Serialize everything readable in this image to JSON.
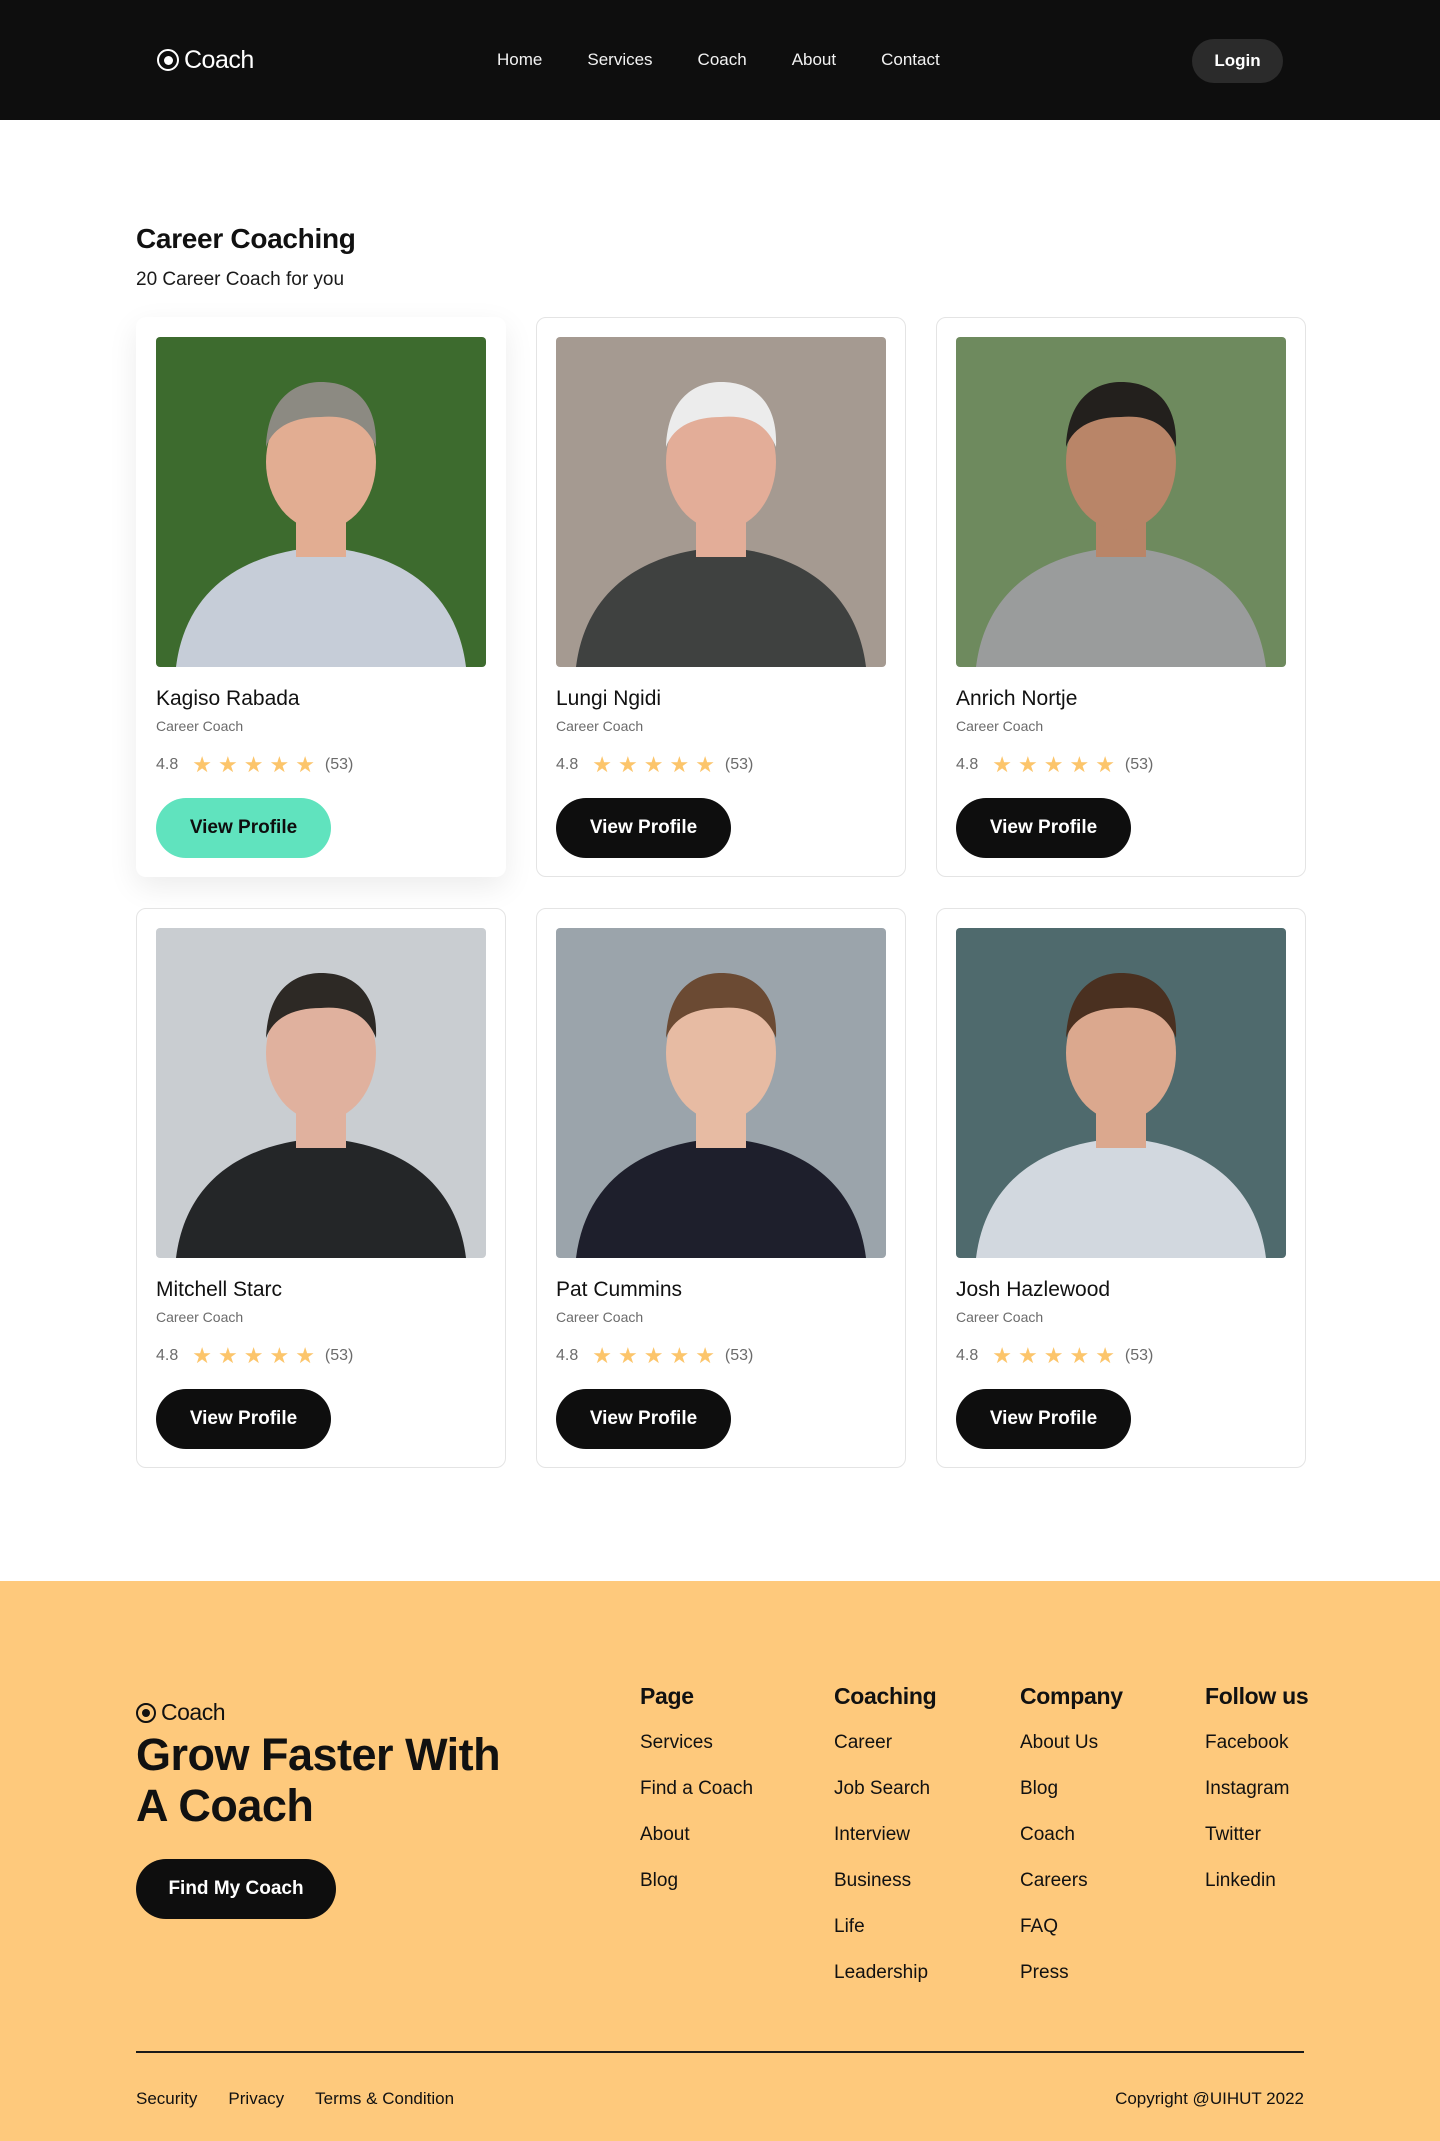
{
  "header": {
    "logo_text": "Coach",
    "nav": [
      "Home",
      "Services",
      "Coach",
      "About",
      "Contact"
    ],
    "login_label": "Login"
  },
  "main": {
    "title": "Career Coaching",
    "subtitle": "20 Career Coach for you",
    "coaches": [
      {
        "name": "Kagiso Rabada",
        "role": "Career Coach",
        "rating": "4.8",
        "stars": 5,
        "reviews": "(53)",
        "button": "View Profile",
        "active": true,
        "photo_bg": "#3d6b2e",
        "shirt": "#c6cdd8",
        "skin": "#e2ad92",
        "hair": "#8c8a82"
      },
      {
        "name": "Lungi Ngidi",
        "role": "Career Coach",
        "rating": "4.8",
        "stars": 5,
        "reviews": "(53)",
        "button": "View Profile",
        "active": false,
        "photo_bg": "#a59a91",
        "shirt": "#3f4140",
        "skin": "#e3ad98",
        "hair": "#ececec"
      },
      {
        "name": "Anrich Nortje",
        "role": "Career Coach",
        "rating": "4.8",
        "stars": 5,
        "reviews": "(53)",
        "button": "View Profile",
        "active": false,
        "photo_bg": "#6e8a5e",
        "shirt": "#9a9c9c",
        "skin": "#b98568",
        "hair": "#23201d"
      },
      {
        "name": "Mitchell Starc",
        "role": "Career Coach",
        "rating": "4.8",
        "stars": 5,
        "reviews": "(53)",
        "button": "View Profile",
        "active": false,
        "photo_bg": "#c9cdd1",
        "shirt": "#242628",
        "skin": "#e0b19e",
        "hair": "#2d2925"
      },
      {
        "name": "Pat Cummins",
        "role": "Career Coach",
        "rating": "4.8",
        "stars": 5,
        "reviews": "(53)",
        "button": "View Profile",
        "active": false,
        "photo_bg": "#9ba4ab",
        "shirt": "#1e1f2c",
        "skin": "#e7bba3",
        "hair": "#6b4a33"
      },
      {
        "name": "Josh Hazlewood",
        "role": "Career Coach",
        "rating": "4.8",
        "stars": 5,
        "reviews": "(53)",
        "button": "View Profile",
        "active": false,
        "photo_bg": "#4f6a6d",
        "shirt": "#d2d8df",
        "skin": "#dba88e",
        "hair": "#4a3020"
      }
    ]
  },
  "footer": {
    "logo_text": "Coach",
    "headline_line1": "Grow Faster With",
    "headline_line2": "A Coach",
    "cta": "Find My Coach",
    "columns": [
      {
        "title": "Page",
        "links": [
          "Services",
          "Find a Coach",
          "About",
          "Blog"
        ]
      },
      {
        "title": "Coaching",
        "links": [
          "Career",
          "Job Search",
          "Interview",
          "Business",
          "Life",
          "Leadership"
        ]
      },
      {
        "title": "Company",
        "links": [
          "About Us",
          "Blog",
          "Coach",
          "Careers",
          "FAQ",
          "Press"
        ]
      },
      {
        "title": "Follow us",
        "links": [
          "Facebook",
          "Instagram",
          "Twitter",
          "Linkedin"
        ]
      }
    ],
    "legal": [
      "Security",
      "Privacy",
      "Terms & Condition"
    ],
    "copyright": "Copyright @UIHUT 2022"
  },
  "colors": {
    "header_bg": "#0e0e0e",
    "accent_active": "#60e3be",
    "star": "#fcc56b",
    "footer_bg": "#fec97c"
  },
  "icons": [
    "logo-ring-icon",
    "star-icon"
  ]
}
